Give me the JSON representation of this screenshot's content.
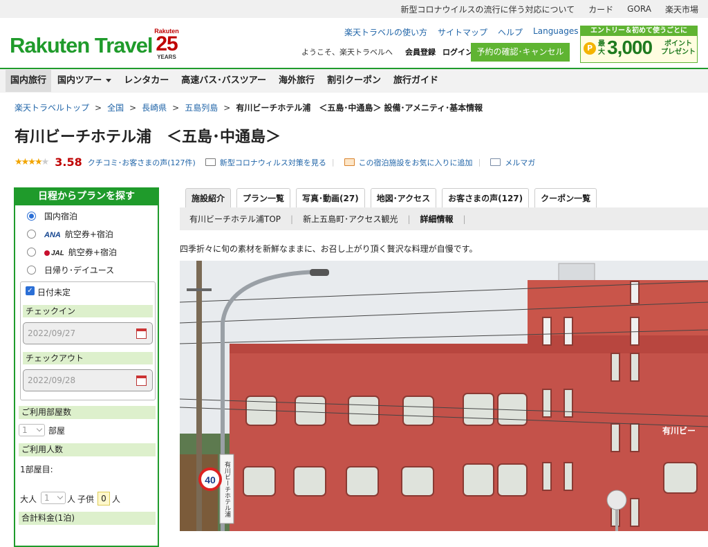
{
  "topbar": {
    "links": [
      "新型コロナウイルスの流行に伴う対応について",
      "カード",
      "GORA",
      "楽天市場"
    ]
  },
  "header": {
    "logo": "Rakuten Travel",
    "anniv_brand": "Rakuten",
    "anniv_number": "25",
    "anniv_years": "YEARS",
    "nav": [
      "楽天トラベルの使い方",
      "サイトマップ",
      "ヘルプ",
      "Languages"
    ],
    "welcome": "ようこそ、楽天トラベルへ",
    "register": "会員登録",
    "login": "ログイン",
    "reservation_button": "予約の確認･キャンセル",
    "promo_title": "エントリー＆初めて使うごとに",
    "promo_max": "最大",
    "promo_amount": "3,000",
    "promo_points": "ポイント",
    "promo_present": "プレゼント",
    "promo_coin": "P"
  },
  "globalnav": [
    "国内旅行",
    "国内ツアー",
    "レンタカー",
    "高速バス･バスツアー",
    "海外旅行",
    "割引クーポン",
    "旅行ガイド"
  ],
  "breadcrumb": [
    "楽天トラベルトップ",
    "全国",
    "長崎県",
    "五島列島"
  ],
  "breadcrumb_current": "有川ビーチホテル浦　＜五島･中通島＞ 設備･アメニティ･基本情報",
  "breadcrumb_sep": ">",
  "hotel": {
    "title": "有川ビーチホテル浦　＜五島･中通島＞",
    "stars_full": "★★★★",
    "stars_empty": "★",
    "score": "3.58",
    "reviews_link": "クチコミ･お客さまの声(127件)",
    "covid_link": "新型コロナウィルス対策を見る",
    "favorite_link": "この宿泊施設をお気に入りに追加",
    "mail_link": "メルマガ",
    "separator": "|"
  },
  "sidebar": {
    "title": "日程からプランを探す",
    "options": [
      {
        "label": "国内宿泊",
        "airline": ""
      },
      {
        "label": "航空券+宿泊",
        "airline": "ANA"
      },
      {
        "label": "航空券+宿泊",
        "airline": "JAL"
      },
      {
        "label": "日帰り･デイユース",
        "airline": ""
      }
    ],
    "date_undecided": "日付未定",
    "checkmark": "✓",
    "checkin_label": "チェックイン",
    "checkin_value": "2022/09/27",
    "checkout_label": "チェックアウト",
    "checkout_value": "2022/09/28",
    "rooms_label": "ご利用部屋数",
    "rooms_value": "1",
    "rooms_unit": "部屋",
    "people_label": "ご利用人数",
    "room1_label": "1部屋目:",
    "adults_label": "大人",
    "adults_value": "1",
    "adults_unit": "人",
    "kids_label": "子供",
    "kids_value": "0",
    "kids_unit": "人",
    "total_label": "合計料金(1泊)"
  },
  "tabs": [
    "施設紹介",
    "プラン一覧",
    "写真･動画(27)",
    "地図･アクセス",
    "お客さまの声(127)",
    "クーポン一覧"
  ],
  "subtabs": [
    "有川ビーチホテル浦TOP",
    "新上五島町･アクセス観光",
    "詳細情報"
  ],
  "subtab_sep": "|",
  "description": "四季折々に旬の素材を新鮮なままに、お召し上がり頂く贅沢な料理が自慢です。",
  "photo": {
    "building_sign": "有川ビー",
    "vertical_sign": "有川ビーチホテル浦",
    "speed_limit": "40",
    "colors": {
      "building": "#c9554a",
      "sky": "#e8ebee"
    }
  }
}
